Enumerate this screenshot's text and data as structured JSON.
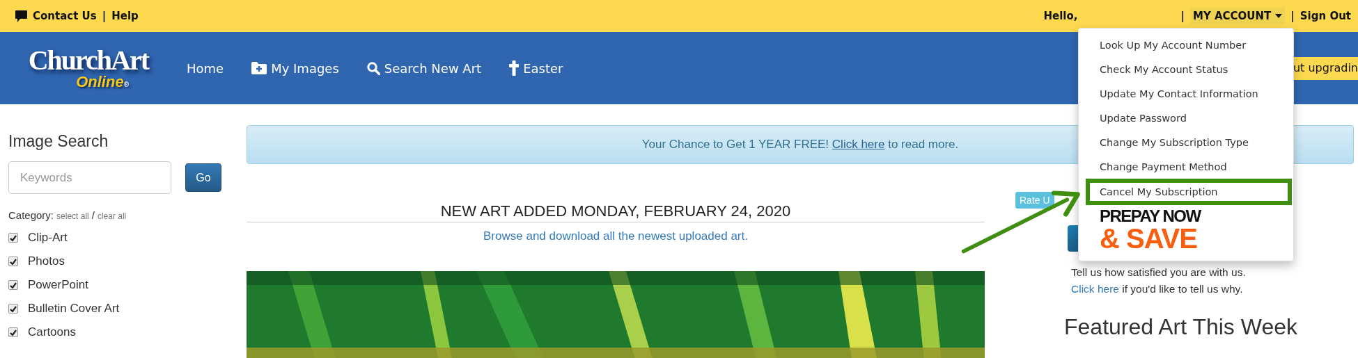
{
  "top_bar": {
    "contact": "Contact Us",
    "separator": "|",
    "help": "Help",
    "greeting": "Hello,",
    "account_separator": "|",
    "account_menu": {
      "label": "MY ACCOUNT",
      "expanded": true
    },
    "signout_separator": "|",
    "sign_out": "Sign Out"
  },
  "nav": {
    "logo": {
      "main": "ChurchArt",
      "sub": "Online",
      "mark": "®"
    },
    "items": [
      {
        "label": "Home",
        "kind": "plain"
      },
      {
        "label": "My Images",
        "kind": "folder"
      },
      {
        "label": "Search New Art",
        "kind": "search"
      },
      {
        "label": "Easter",
        "kind": "cross"
      }
    ],
    "banner": "ut upgradin"
  },
  "account_dropdown": {
    "items": [
      {
        "label": "Look Up My Account Number",
        "highlighted": false
      },
      {
        "label": "Check My Account Status",
        "highlighted": false
      },
      {
        "label": "Update My Contact Information",
        "highlighted": false
      },
      {
        "label": "Update Password",
        "highlighted": false
      },
      {
        "label": "Change My Subscription Type",
        "highlighted": false
      },
      {
        "label": "Change Payment Method",
        "highlighted": false
      },
      {
        "label": "Cancel My Subscription",
        "highlighted": true
      }
    ],
    "promo": {
      "line_1": "PREPAY NOW",
      "line_2": "& SAVE"
    }
  },
  "sidebar": {
    "title": "Image Search",
    "search": {
      "placeholder": "Keywords"
    },
    "go_button": "Go",
    "category_label": "Category:",
    "select_all": "select all",
    "slash": "/",
    "clear_all": "clear all",
    "categories": [
      {
        "label": "Clip-Art",
        "checked": true
      },
      {
        "label": "Photos",
        "checked": true
      },
      {
        "label": "PowerPoint",
        "checked": true
      },
      {
        "label": "Bulletin Cover Art",
        "checked": true
      },
      {
        "label": "Cartoons",
        "checked": true
      }
    ]
  },
  "alert": {
    "text": "Your Chance to Get 1 YEAR FREE!",
    "link": "Click here",
    "after": "to read more."
  },
  "new_art": {
    "heading": "NEW ART ADDED MONDAY, FEBRUARY 24, 2020",
    "subtitle": "Browse and download all the newest uploaded art."
  },
  "right_column": {
    "rate_button": "Rate U",
    "feedback_line": "Tell us how satisfied you are with us.",
    "feedback_link": "Click here",
    "feedback_after": "if you'd like to tell us why.",
    "featured_title": "Featured Art This Week"
  }
}
